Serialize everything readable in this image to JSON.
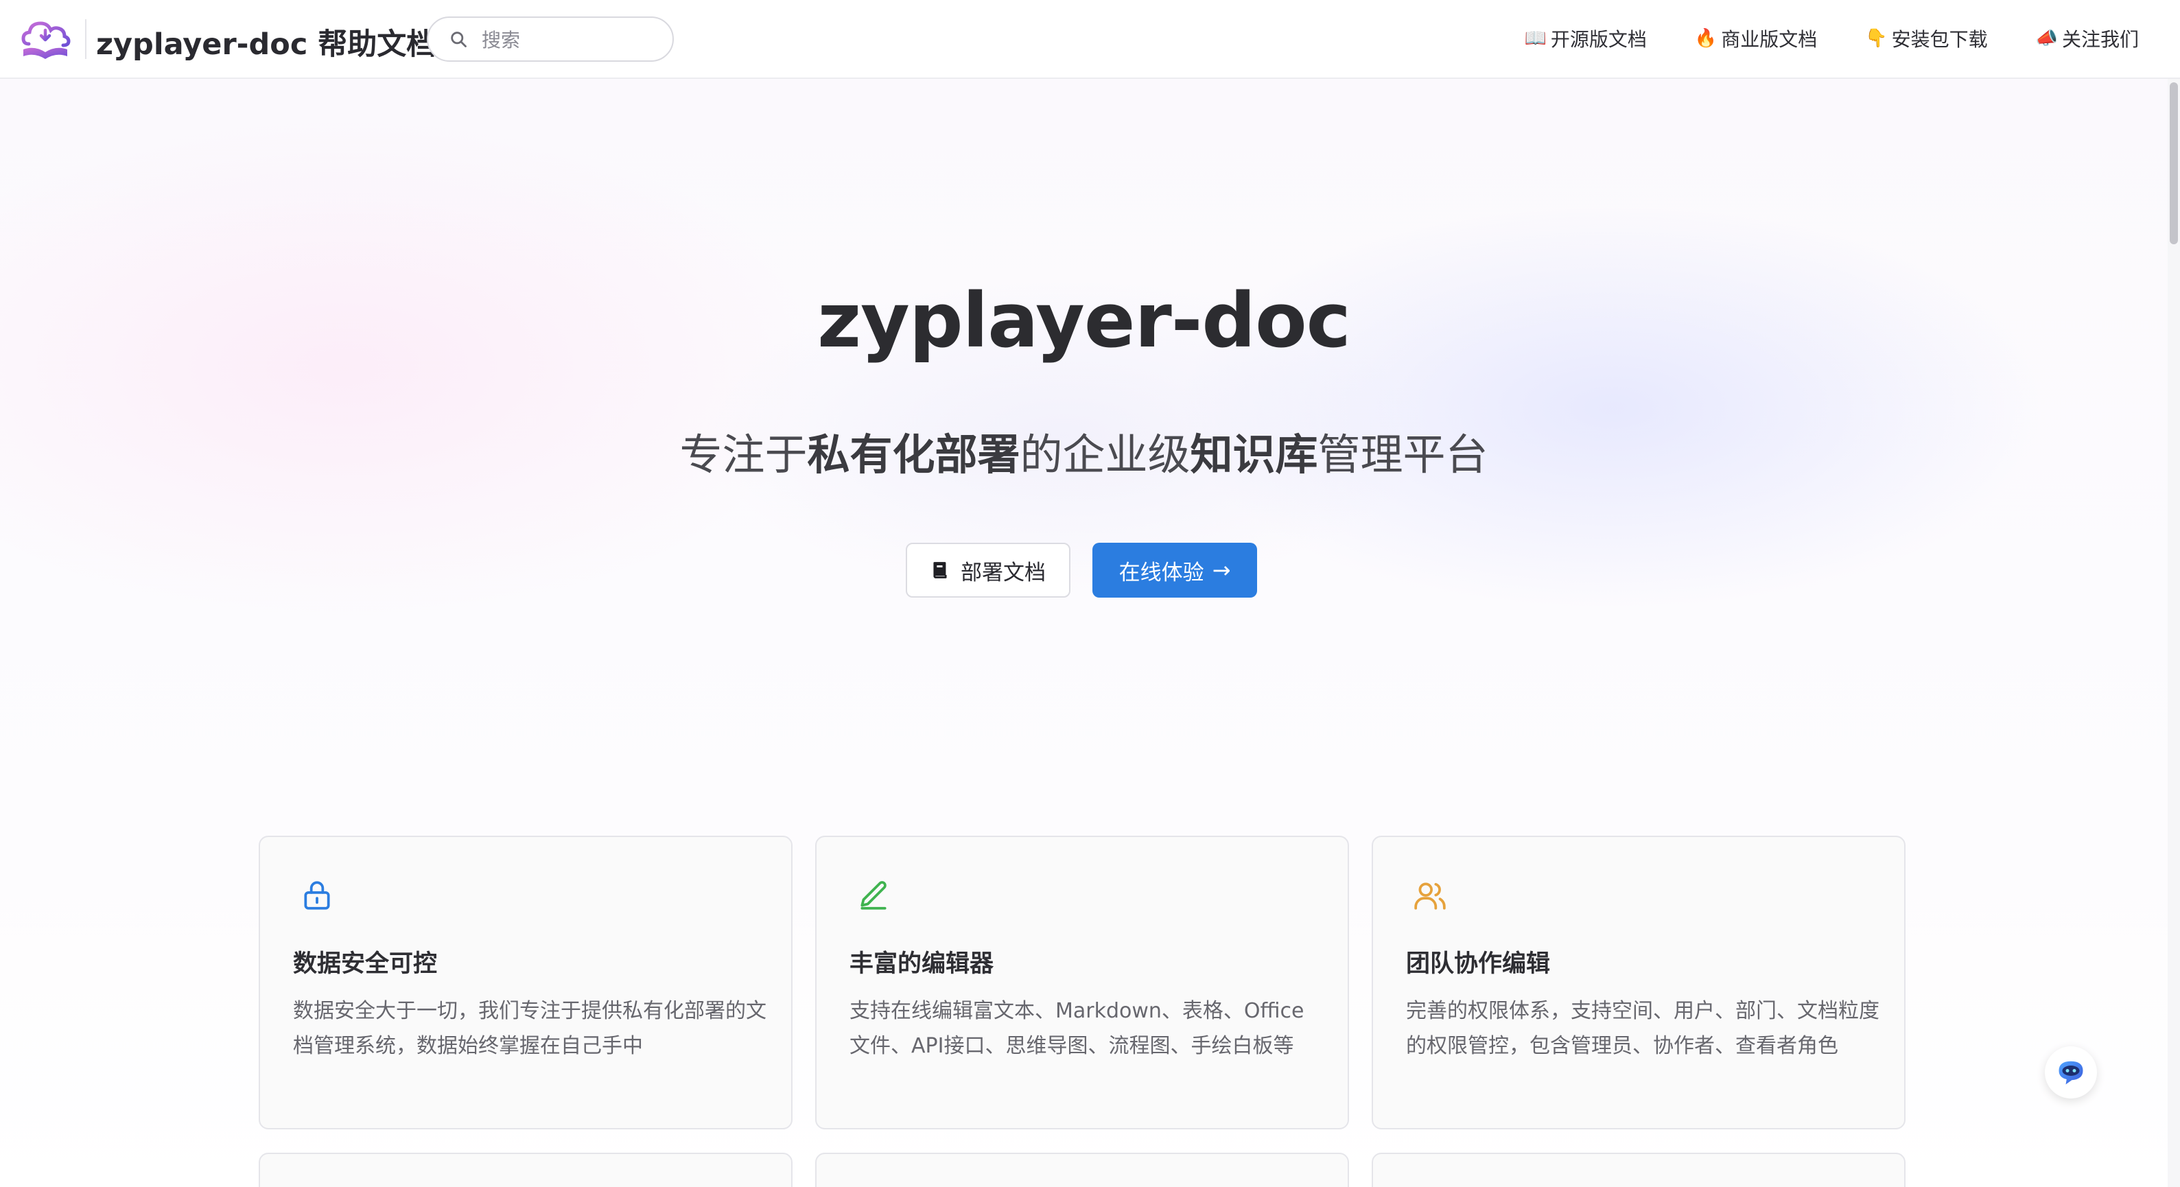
{
  "header": {
    "site_title": "zyplayer-doc 帮助文档",
    "search_placeholder": "搜索",
    "links": [
      {
        "icon": "📖",
        "icon_name": "open-book-icon",
        "label": "开源版文档"
      },
      {
        "icon": "🔥",
        "icon_name": "fire-icon",
        "label": "商业版文档"
      },
      {
        "icon": "👇",
        "icon_name": "pointing-down-icon",
        "label": "安装包下载"
      },
      {
        "icon": "📣",
        "icon_name": "megaphone-icon",
        "label": "关注我们"
      }
    ]
  },
  "hero": {
    "title": "zyplayer-doc",
    "subtitle": {
      "part1": "专注于",
      "bold1": "私有化部署",
      "part2": "的企业级",
      "bold2": "知识库",
      "part3": "管理平台"
    },
    "docs_button": "部署文档",
    "try_button": "在线体验",
    "try_button_arrow": "→"
  },
  "features": [
    {
      "icon": "lock-icon",
      "icon_color": "#2b7de0",
      "title": "数据安全可控",
      "desc": "数据安全大于一切，我们专注于提供私有化部署的文档管理系统，数据始终掌握在自己手中"
    },
    {
      "icon": "edit-pen-icon",
      "icon_color": "#3fb34f",
      "title": "丰富的编辑器",
      "desc": "支持在线编辑富文本、Markdown、表格、Office文件、API接口、思维导图、流程图、手绘白板等"
    },
    {
      "icon": "users-icon",
      "icon_color": "#e6a23c",
      "title": "团队协作编辑",
      "desc": "完善的权限体系，支持空间、用户、部门、文档粒度的权限管控，包含管理员、协作者、查看者角色"
    }
  ],
  "colors": {
    "primary": "#2b7de0",
    "text": "#3c3c43"
  }
}
